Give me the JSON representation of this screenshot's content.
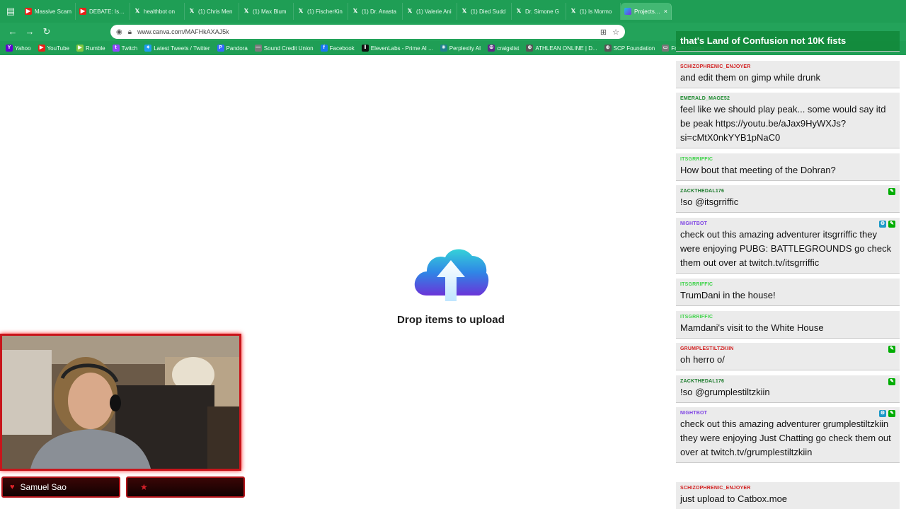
{
  "browser": {
    "tabs": [
      {
        "label": "Massive Scam",
        "icon": "youtube-icon",
        "active": false
      },
      {
        "label": "DEBATE: Is Fe",
        "icon": "youtube-icon",
        "active": false
      },
      {
        "label": "healthbot on",
        "icon": "x-icon",
        "active": false
      },
      {
        "label": "(1) Chris Men",
        "icon": "x-icon",
        "active": false
      },
      {
        "label": "(1) Max Blum",
        "icon": "x-icon",
        "active": false
      },
      {
        "label": "(1) FischerKin",
        "icon": "x-icon",
        "active": false
      },
      {
        "label": "(1) Dr. Anasta",
        "icon": "x-icon",
        "active": false
      },
      {
        "label": "(1) Valerie Ani",
        "icon": "x-icon",
        "active": false
      },
      {
        "label": "(1) Died Sudd",
        "icon": "x-icon",
        "active": false
      },
      {
        "label": "Dr. Simone G",
        "icon": "x-icon",
        "active": false
      },
      {
        "label": "(1) Is Mormo",
        "icon": "x-icon",
        "active": false
      },
      {
        "label": "Projects - C",
        "icon": "canva-icon",
        "active": true
      }
    ],
    "url": "www.canva.com/MAFHkAXAJ5k",
    "bookmarks": [
      {
        "label": "Yahoo",
        "icon": "yahoo-icon",
        "color": "#6001d2"
      },
      {
        "label": "YouTube",
        "icon": "youtube-icon",
        "color": "#e62117"
      },
      {
        "label": "Rumble",
        "icon": "rumble-icon",
        "color": "#85c742"
      },
      {
        "label": "Twitch",
        "icon": "twitch-icon",
        "color": "#9146ff"
      },
      {
        "label": "Latest Tweets / Twitter",
        "icon": "bird-icon",
        "color": "#1d9bf0"
      },
      {
        "label": "Pandora",
        "icon": "pandora-icon",
        "color": "#3668ff"
      },
      {
        "label": "Sound Credit Union",
        "icon": "dash-icon",
        "color": "#7a7a7a"
      },
      {
        "label": "Facebook",
        "icon": "facebook-icon",
        "color": "#1877f2"
      },
      {
        "label": "ElevenLabs - Prime AI ...",
        "icon": "elevenlabs-icon",
        "color": "#111111"
      },
      {
        "label": "Perplexity AI",
        "icon": "perplexity-icon",
        "color": "#20808d"
      },
      {
        "label": "craigslist",
        "icon": "peace-icon",
        "color": "#5e2a84"
      },
      {
        "label": "ATHLEAN ONLINE | D...",
        "icon": "globe-icon",
        "color": "#555555"
      },
      {
        "label": "SCP Foundation",
        "icon": "globe-icon",
        "color": "#555555"
      },
      {
        "label": "From Google",
        "icon": "folder-icon",
        "color": "#777777"
      }
    ]
  },
  "main": {
    "drop_label": "Drop items to upload",
    "cloud_icon": "cloud-upload-icon"
  },
  "chat": {
    "messages": [
      {
        "user": "",
        "text": "that's Land of Confusion not 10K fists",
        "highlight": true,
        "user_color": "#ffffff"
      },
      {
        "user": "SCHIZOPHRENIC_ENJOYER",
        "text": "and edit them on gimp while drunk",
        "user_color": "#d21f1f"
      },
      {
        "user": "EMERALD_MAGE52",
        "text": "feel like we should play peak... some would say itd be peak https://youtu.be/aJax9HyWXJs?si=cMtX0nkYYB1pNaC0",
        "user_color": "#1c8a2e"
      },
      {
        "user": "ITSGRRIFFIC",
        "text": "How bout that meeting of the Dohran?",
        "user_color": "#3fd34a"
      },
      {
        "user": "ZACKTHEDAL176",
        "text": "!so @itsgrriffic",
        "user_color": "#1a7a2a",
        "mod": true
      },
      {
        "user": "NIGHTBOT",
        "text": "check out this amazing adventurer itsgrriffic they were enjoying PUBG: BATTLEGROUNDS go check them out over at twitch.tv/itsgrriffic",
        "user_color": "#7b3fe4",
        "bot": true,
        "mod": true
      },
      {
        "user": "ITSGRRIFFIC",
        "text": "TrumDani in the house!",
        "user_color": "#3fd34a"
      },
      {
        "user": "ITSGRRIFFIC",
        "text": "Mamdani's visit to the White House",
        "user_color": "#3fd34a"
      },
      {
        "user": "GRUMPLESTILTZKIIN",
        "text": "oh herro o/",
        "user_color": "#d21f1f",
        "mod": true
      },
      {
        "user": "ZACKTHEDAL176",
        "text": "!so @grumplestiltzkiin",
        "user_color": "#1a7a2a",
        "mod": true
      },
      {
        "user": "NIGHTBOT",
        "text": "check out this amazing adventurer grumplestiltzkiin they were enjoying Just Chatting go check them out over at twitch.tv/grumplestiltzkiin",
        "user_color": "#7b3fe4",
        "bot": true,
        "mod": true
      },
      {
        "user": "SCHIZOPHRENIC_ENJOYER",
        "text": "just upload to Catbox.moe",
        "user_color": "#d21f1f"
      }
    ]
  },
  "stream": {
    "streamer_name": "Samuel Sao",
    "name_icon": "heart-icon",
    "accent": "#c8151b"
  }
}
